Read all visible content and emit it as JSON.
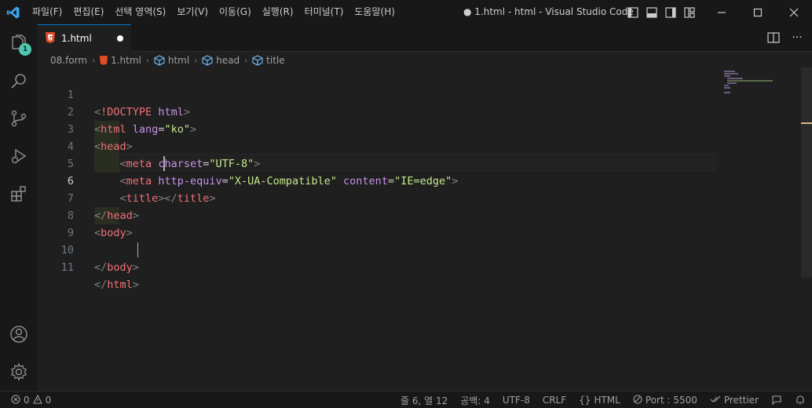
{
  "titlebar": {
    "menus": [
      "파일(F)",
      "편집(E)",
      "선택 영역(S)",
      "보기(V)",
      "이동(G)",
      "실행(R)",
      "터미널(T)",
      "도움말(H)"
    ],
    "title": "● 1.html - html - Visual Studio Code"
  },
  "activity": {
    "explorer_badge": "1"
  },
  "tab": {
    "label": "1.html"
  },
  "breadcrumb": {
    "items": [
      "08.form",
      "1.html",
      "html",
      "head",
      "title"
    ]
  },
  "editor": {
    "line_numbers": [
      "1",
      "2",
      "3",
      "4",
      "5",
      "6",
      "7",
      "8",
      "9",
      "10",
      "11"
    ],
    "current_line": 6
  },
  "statusbar": {
    "errors": "0",
    "warnings": "0",
    "position": "줄 6, 열 12",
    "spaces": "공백: 4",
    "encoding": "UTF-8",
    "eol": "CRLF",
    "language": "HTML",
    "port": "Port : 5500",
    "formatter": "Prettier"
  },
  "colors": {
    "accent": "#0078d4",
    "badge": "#4ec9b0",
    "tag": "#f07178",
    "attr": "#c792ea",
    "string": "#c3e88d"
  }
}
